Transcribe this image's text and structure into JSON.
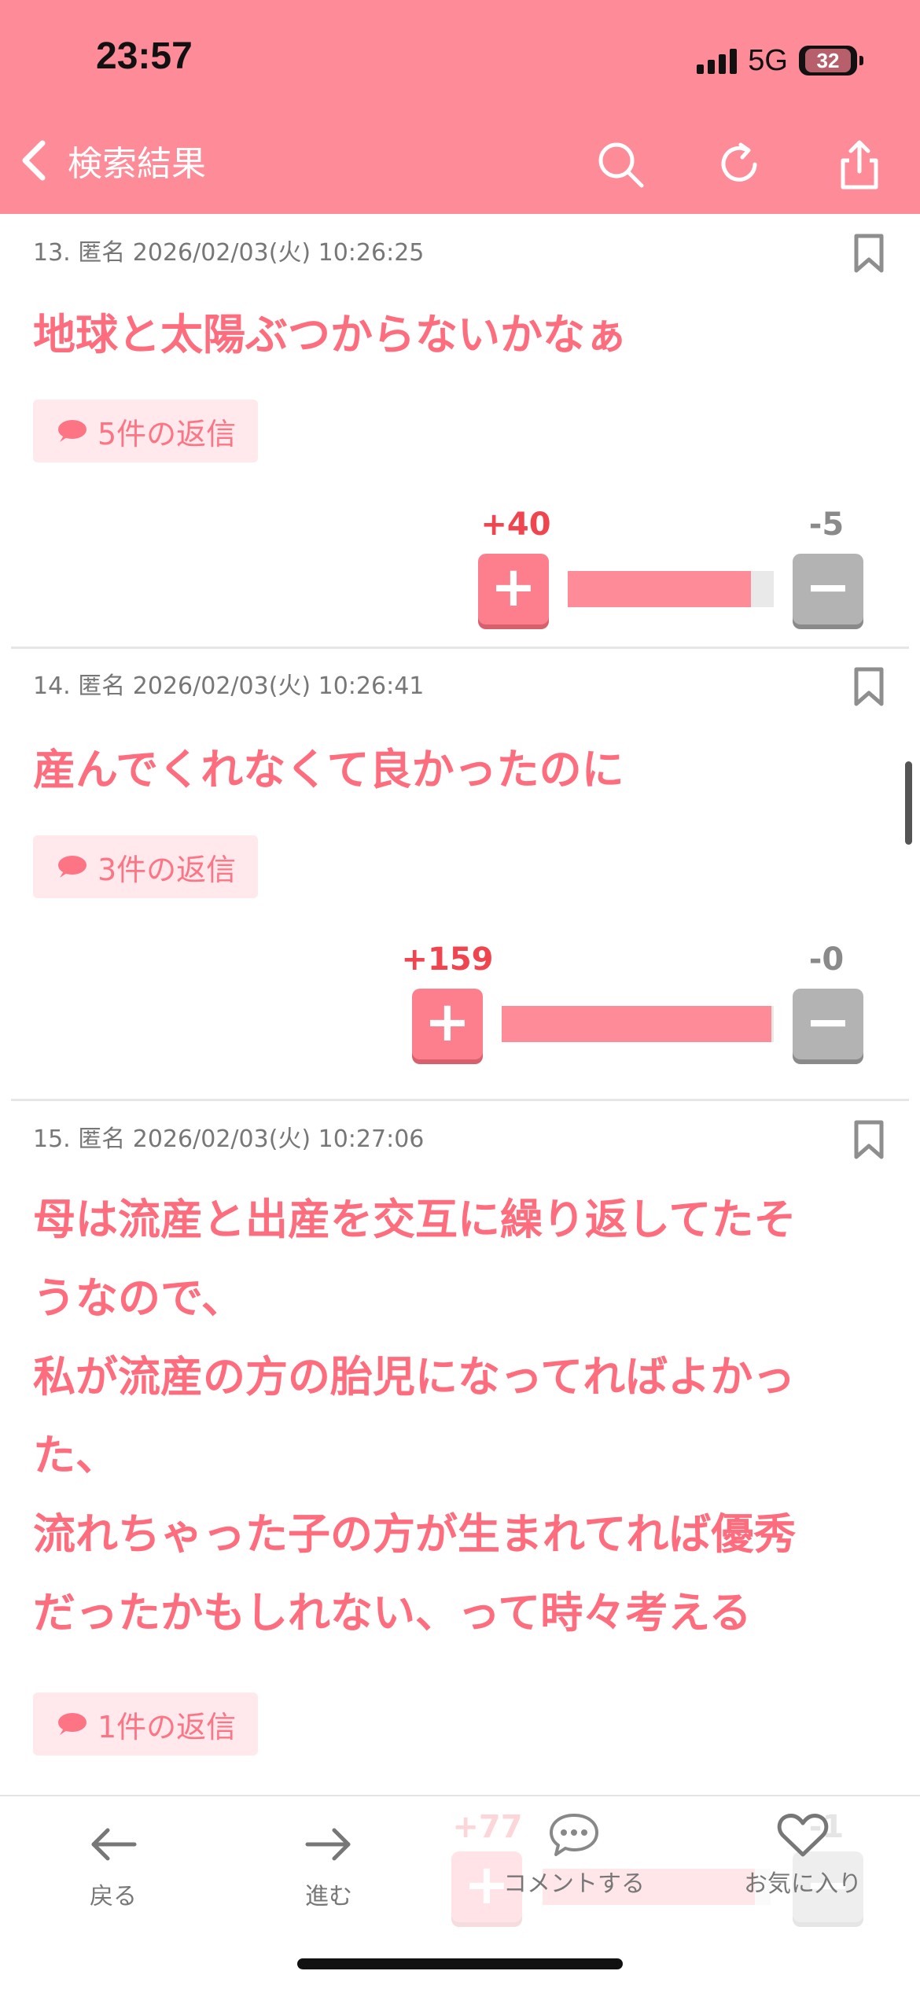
{
  "status_bar": {
    "time": "23:57",
    "network": "5G",
    "battery": "32"
  },
  "header": {
    "title": "検索結果",
    "back_icon": "chevron-left-icon",
    "icons": [
      "search-icon",
      "reload-icon",
      "share-icon"
    ]
  },
  "posts": [
    {
      "meta": "13. 匿名 2026/02/03(火) 10:26:25",
      "body": "地球と太陽ぶつからないかなぁ",
      "replies": "5件の返信",
      "plus": "+40",
      "minus": "-5",
      "plus_ratio": 0.89
    },
    {
      "meta": "14. 匿名 2026/02/03(火) 10:26:41",
      "body": "産んでくれなくて良かったのに",
      "replies": "3件の返信",
      "plus": "+159",
      "minus": "-0",
      "plus_ratio": 0.99
    },
    {
      "meta": "15. 匿名 2026/02/03(火) 10:27:06",
      "body_lines": [
        "母は流産と出産を交互に繰り返してたそ",
        "うなので、",
        "私が流産の方の胎児になってればよかっ",
        "た、",
        "流れちゃった子の方が生まれてれば優秀",
        "だったかもしれない、って時々考える"
      ],
      "replies": "1件の返信",
      "plus": "+77",
      "minus": "-1"
    }
  ],
  "bottom_nav": [
    {
      "label": "戻る",
      "icon": "arrow-left-icon"
    },
    {
      "label": "進む",
      "icon": "arrow-right-icon"
    },
    {
      "label": "コメントする",
      "icon": "comment-icon"
    },
    {
      "label": "お気に入り",
      "icon": "heart-icon"
    }
  ]
}
